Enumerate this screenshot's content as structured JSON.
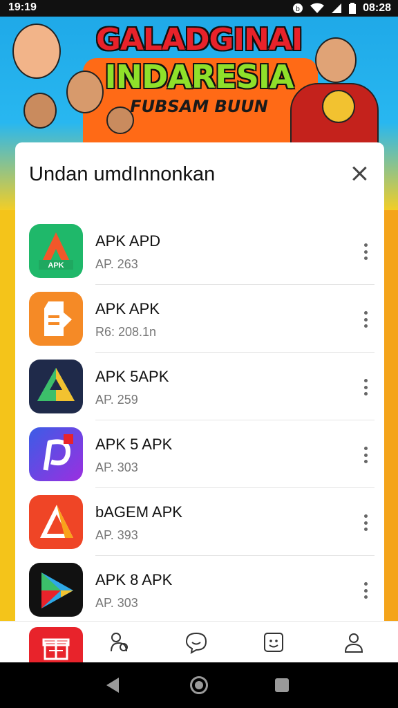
{
  "status_bar": {
    "time": "19:19",
    "clock": "08:28",
    "icons": [
      "notification-icon",
      "wifi-icon",
      "signal-icon",
      "battery-icon"
    ]
  },
  "banner": {
    "title_line1": "GALADGINAI",
    "title_line2": "INDARESIA",
    "subtitle": "FUBSAM BUUN"
  },
  "sheet": {
    "title": "Undan umdInnonkan",
    "apps": [
      {
        "name": "APK APD",
        "meta": "AP. 263",
        "icon": "green-a-icon"
      },
      {
        "name": "APK APK",
        "meta": "R6: 208.1n",
        "icon": "orange-robot-icon"
      },
      {
        "name": "APK 5APK",
        "meta": "AP. 259",
        "icon": "dark-triangle-icon"
      },
      {
        "name": "APK 5 APK",
        "meta": "AP. 303",
        "icon": "purple-p-icon"
      },
      {
        "name": "bAGEM APK",
        "meta": "AP. 393",
        "icon": "red-a-icon"
      },
      {
        "name": "APK 8 APK",
        "meta": "AP. 303",
        "icon": "play-triangle-icon"
      }
    ]
  },
  "bottom_nav": {
    "items": [
      "gift-icon",
      "flask-icon",
      "chat-icon",
      "face-icon",
      "profile-icon"
    ]
  },
  "colors": {
    "accent_red": "#e8232b",
    "banner_blue": "#1fa9e8",
    "banner_yellow": "#ffcf1a"
  }
}
